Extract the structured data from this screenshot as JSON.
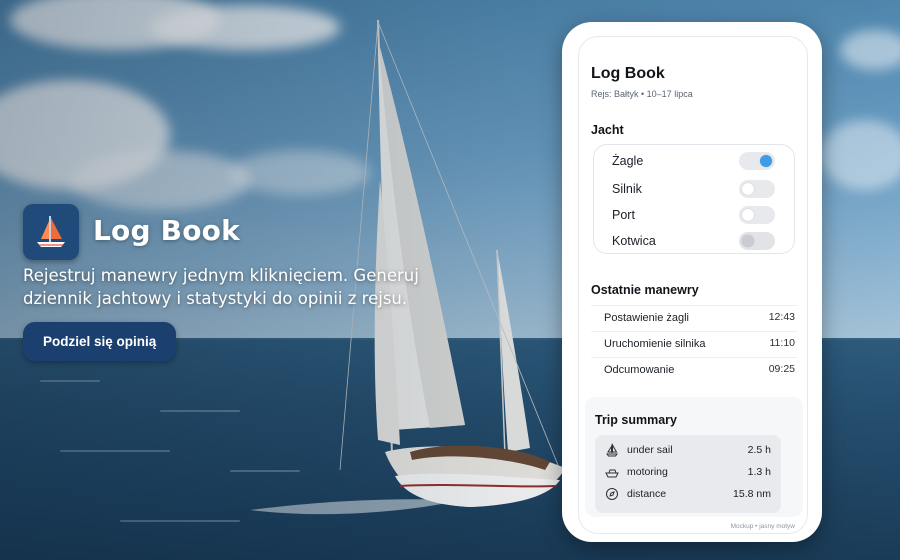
{
  "hero": {
    "app_name": "Log Book",
    "app_icon": "sailboat-icon",
    "tagline": "Rejestruj manewry jednym kliknięciem. Generuj dziennik jachtowy i statystyki do opinii z rejsu.",
    "cta_label": "Podziel się opinią"
  },
  "phone": {
    "title": "Log Book",
    "subtitle": "Rejs: Bałtyk • 10–17 lipca",
    "yacht_section": "Jacht",
    "toggles": [
      {
        "label": "Żagle",
        "state": "on"
      },
      {
        "label": "Silnik",
        "state": "off"
      },
      {
        "label": "Port",
        "state": "off"
      },
      {
        "label": "Kotwica",
        "state": "disabled"
      }
    ],
    "maneuvers_section": "Ostatnie manewry",
    "maneuvers": [
      {
        "name": "Postawienie żagli",
        "time": "12:43"
      },
      {
        "name": "Uruchomienie silnika",
        "time": "11:10"
      },
      {
        "name": "Odcumowanie",
        "time": "09:25"
      }
    ],
    "summary": {
      "title": "Trip summary",
      "rows": [
        {
          "icon": "sail-icon",
          "label": "under sail",
          "value": "2.5 h"
        },
        {
          "icon": "motorboat-icon",
          "label": "motoring",
          "value": "1.3 h"
        },
        {
          "icon": "compass-icon",
          "label": "distance",
          "value": "15.8 nm"
        }
      ]
    },
    "footnote": "Mockup • jasny motyw"
  },
  "colors": {
    "accent": "#3d9be9",
    "button_bg": "#1b3f6e",
    "icon_bg": "#1f4a7a"
  }
}
